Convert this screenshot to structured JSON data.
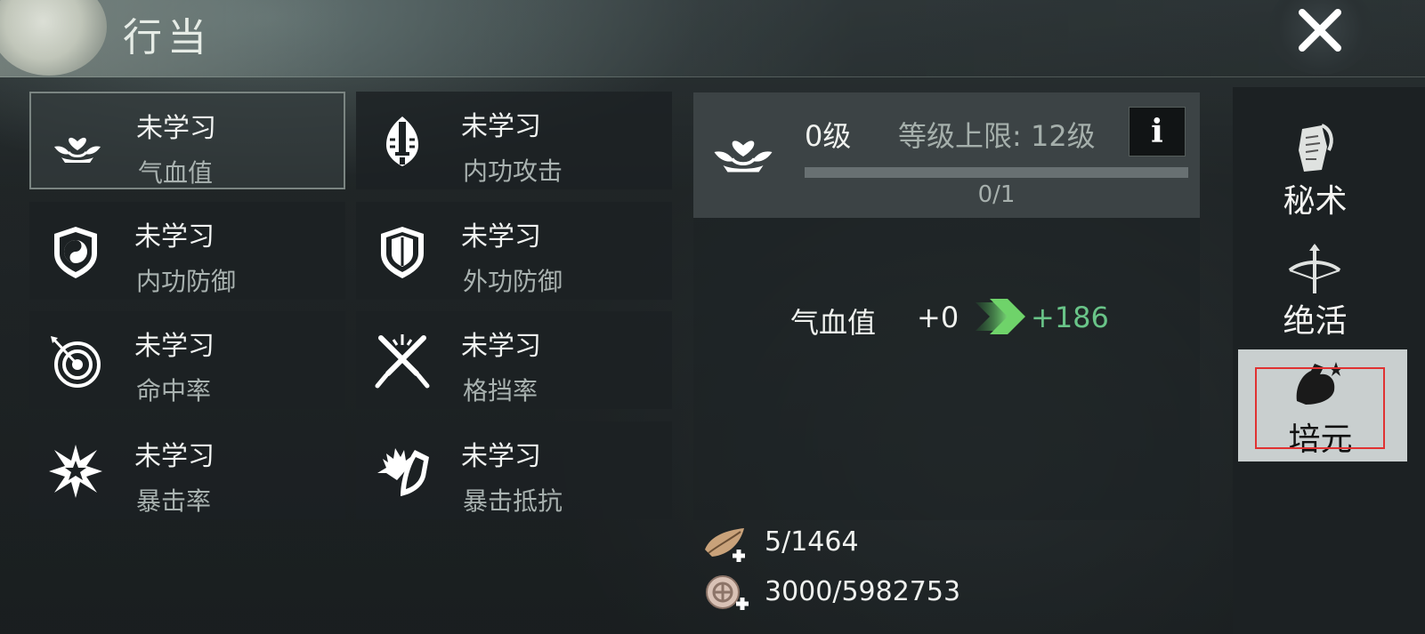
{
  "window": {
    "title": "行当",
    "close_icon": "close-icon"
  },
  "skills": [
    {
      "status": "未学习",
      "name": "气血值",
      "icon": "lotus-heart-icon",
      "selected": true
    },
    {
      "status": "未学习",
      "name": "内功攻击",
      "icon": "sword-emblem-icon",
      "selected": false
    },
    {
      "status": "未学习",
      "name": "内功防御",
      "icon": "yinyang-shield-icon",
      "selected": false
    },
    {
      "status": "未学习",
      "name": "外功防御",
      "icon": "shield-icon",
      "selected": false
    },
    {
      "status": "未学习",
      "name": "命中率",
      "icon": "target-icon",
      "selected": false
    },
    {
      "status": "未学习",
      "name": "格挡率",
      "icon": "crossed-swords-icon",
      "selected": false
    },
    {
      "status": "未学习",
      "name": "暴击率",
      "icon": "burst-icon",
      "selected": false
    },
    {
      "status": "未学习",
      "name": "暴击抵抗",
      "icon": "burst-shield-icon",
      "selected": false
    }
  ],
  "detail": {
    "icon": "lotus-heart-icon",
    "level": "0级",
    "max_level": "等级上限: 12级",
    "info_label": "i",
    "progress_text": "0/1",
    "progress_fraction": 0,
    "stat_name": "气血值",
    "stat_current": "+0",
    "stat_next": "+186",
    "arrow_icon": "green-arrow-icon"
  },
  "resources": [
    {
      "icon": "leaf-add-icon",
      "value": "5/1464"
    },
    {
      "icon": "coin-add-icon",
      "value": "3000/5982753"
    }
  ],
  "sidebar": [
    {
      "label": "秘术",
      "icon": "scroll-icon",
      "active": false
    },
    {
      "label": "绝活",
      "icon": "crossbow-icon",
      "active": false
    },
    {
      "label": "培元",
      "icon": "muscle-icon",
      "active": true
    }
  ],
  "colors": {
    "accent_green": "#69c488",
    "highlight_frame": "#e03232"
  }
}
